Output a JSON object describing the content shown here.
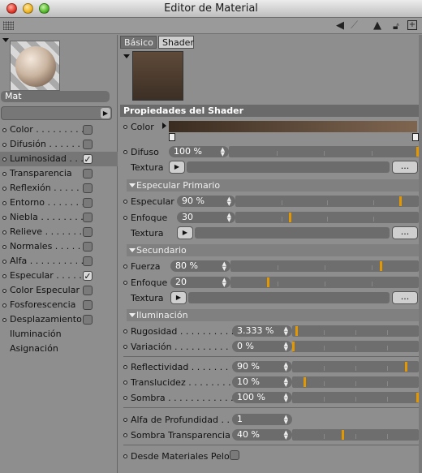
{
  "window": {
    "title": "Editor de Material"
  },
  "toolbar": {
    "icons": [
      "grip-icon",
      "back-arrow-icon",
      "forward-arrow-icon",
      "up-arrow-icon",
      "lock-icon",
      "new-window-icon"
    ]
  },
  "material": {
    "name": "Mat"
  },
  "channels": [
    {
      "label": "Color",
      "dots": " . . . . . . . . .",
      "checked": false,
      "box": true,
      "selected": false
    },
    {
      "label": "Difusión",
      "dots": " . . . . . . .",
      "checked": false,
      "box": true,
      "selected": false
    },
    {
      "label": "Luminosidad",
      "dots": " . . .",
      "checked": true,
      "box": true,
      "selected": true
    },
    {
      "label": "Transparencia",
      "dots": "",
      "checked": false,
      "box": true,
      "selected": false
    },
    {
      "label": "Reflexión",
      "dots": " . . . . . . .",
      "checked": false,
      "box": true,
      "selected": false
    },
    {
      "label": "Entorno",
      "dots": " . . . . . . . .",
      "checked": false,
      "box": true,
      "selected": false
    },
    {
      "label": "Niebla",
      "dots": " . . . . . . . .",
      "checked": false,
      "box": true,
      "selected": false
    },
    {
      "label": "Relieve",
      "dots": " . . . . . . . .",
      "checked": false,
      "box": true,
      "selected": false
    },
    {
      "label": "Normales",
      "dots": " . . . . . . .",
      "checked": false,
      "box": true,
      "selected": false
    },
    {
      "label": "Alfa",
      "dots": " . . . . . . . . . .",
      "checked": false,
      "box": true,
      "selected": false
    },
    {
      "label": "Especular",
      "dots": " . . . . .",
      "checked": true,
      "box": true,
      "selected": false
    },
    {
      "label": "Color Especular",
      "dots": "",
      "checked": false,
      "box": true,
      "selected": false
    },
    {
      "label": "Fosforescencia",
      "dots": "",
      "checked": false,
      "box": true,
      "selected": false
    },
    {
      "label": "Desplazamiento",
      "dots": "",
      "checked": false,
      "box": true,
      "selected": false
    },
    {
      "label": "Iluminación",
      "dots": "",
      "checked": false,
      "box": false,
      "selected": false
    },
    {
      "label": "Asignación",
      "dots": "",
      "checked": false,
      "box": false,
      "selected": false
    }
  ],
  "tabs": {
    "basic": "Básico",
    "shader": "Shader"
  },
  "shader": {
    "section_title": "Propiedades del Shader",
    "color_label": "Color",
    "diffuse_label": "Difuso",
    "diffuse_value": "100 %",
    "diffuse_level": 1.0,
    "texture_label": "Textura",
    "more_button": "...",
    "spec_primary_title": "Especular Primario",
    "specular_label": "Especular",
    "specular_value": "90 %",
    "specular_level": 0.9,
    "focus_label": "Enfoque",
    "focus1_value": "30",
    "focus1_level": 0.3,
    "secondary_title": "Secundario",
    "strength_label": "Fuerza",
    "strength_value": "80 %",
    "strength_level": 0.8,
    "focus2_value": "20",
    "focus2_level": 0.2,
    "lighting_title": "Iluminación",
    "roughness_label": "Rugosidad . . . . . . . . . .",
    "roughness_value": "3.333 %",
    "roughness_level": 0.033,
    "variation_label": "Variación . . . . . . . . . .",
    "variation_value": "0 %",
    "variation_level": 0.0,
    "reflectivity_label": "Reflectividad . . . . . . .",
    "reflectivity_value": "90 %",
    "reflectivity_level": 0.9,
    "translucency_label": "Translucidez . . . . . . . .",
    "translucency_value": "10 %",
    "translucency_level": 0.1,
    "shadow_label": "Sombra . . . . . . . . . . . . .",
    "shadow_value": "100 %",
    "shadow_level": 1.0,
    "depth_alpha_label": "Alfa de Profundidad . .",
    "depth_alpha_value": "1",
    "shadow_transp_label": "Sombra Transparencia",
    "shadow_transp_value": "40 %",
    "shadow_transp_level": 0.4,
    "from_hair_label": "Desde Materiales Pelo"
  },
  "colors": {
    "accent": "#e39800",
    "swatch": "#4d3b2d"
  }
}
